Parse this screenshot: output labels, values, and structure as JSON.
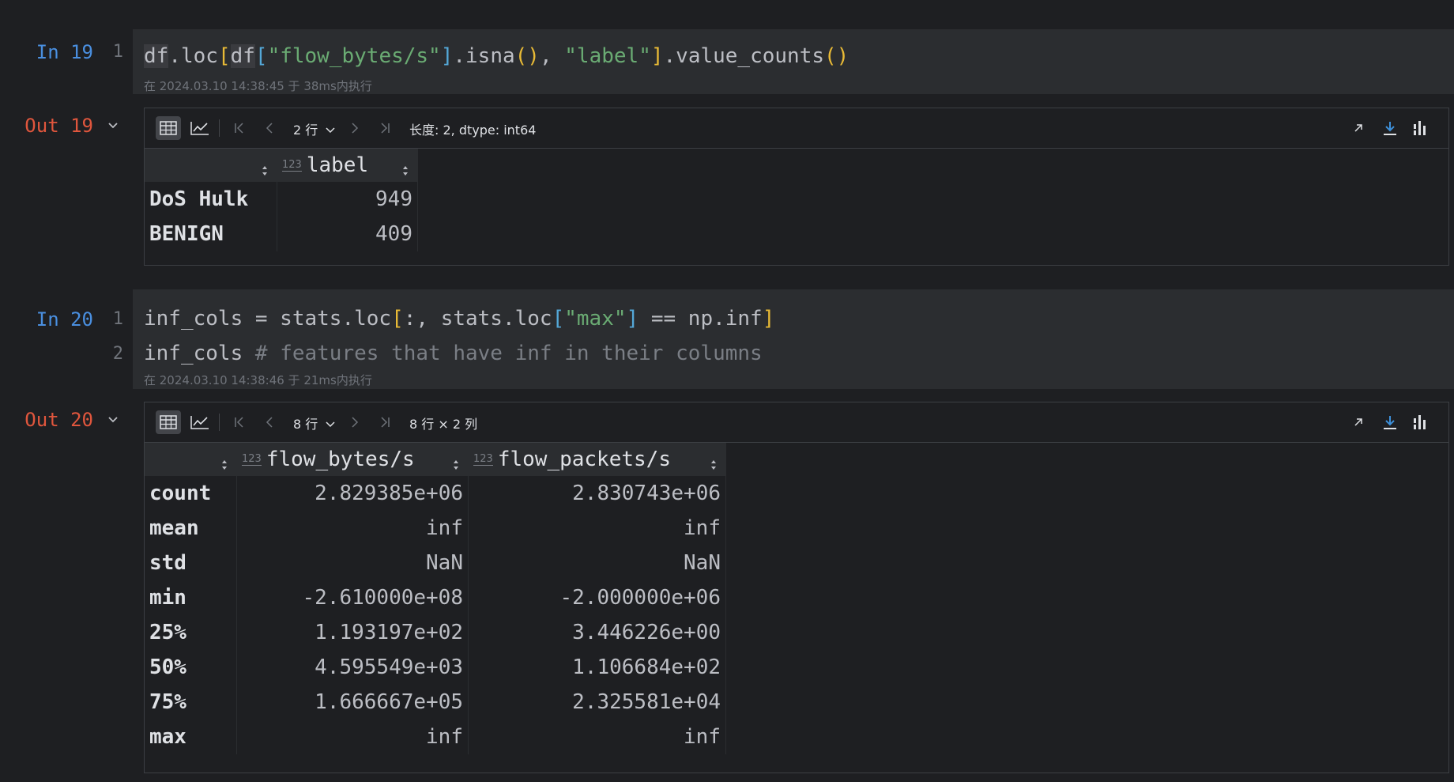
{
  "cells": [
    {
      "in_prompt": "In 19",
      "out_prompt": "Out 19",
      "line_numbers": [
        "1"
      ],
      "code": [
        [
          {
            "t": "df",
            "c": "hl"
          },
          {
            "t": ".loc",
            "c": ""
          },
          {
            "t": "[",
            "c": "br1"
          },
          {
            "t": "df",
            "c": "hl"
          },
          {
            "t": "[",
            "c": "br2"
          },
          {
            "t": "\"flow_bytes/s\"",
            "c": "str"
          },
          {
            "t": "]",
            "c": "br2"
          },
          {
            "t": ".isna",
            "c": ""
          },
          {
            "t": "()",
            "c": "br1"
          },
          {
            "t": ", ",
            "c": ""
          },
          {
            "t": "\"label\"",
            "c": "str"
          },
          {
            "t": "]",
            "c": "br1"
          },
          {
            "t": ".value_counts",
            "c": ""
          },
          {
            "t": "()",
            "c": "br1"
          }
        ]
      ],
      "exec_time": "在 2024.03.10 14:38:45 于 38ms内执行",
      "toolbar": {
        "rows_label": "2 行",
        "info": "长度: 2, dtype: int64"
      },
      "table": {
        "index_header": "",
        "columns": [
          {
            "name": "label",
            "type_badge": "123"
          }
        ],
        "rows": [
          {
            "index": "DoS Hulk",
            "values": [
              "949"
            ]
          },
          {
            "index": "BENIGN",
            "values": [
              "409"
            ]
          }
        ]
      }
    },
    {
      "in_prompt": "In 20",
      "out_prompt": "Out 20",
      "line_numbers": [
        "1",
        "2"
      ],
      "code": [
        [
          {
            "t": "inf_cols = stats.loc",
            "c": ""
          },
          {
            "t": "[",
            "c": "br1"
          },
          {
            "t": ":, stats.loc",
            "c": ""
          },
          {
            "t": "[",
            "c": "br2"
          },
          {
            "t": "\"max\"",
            "c": "str"
          },
          {
            "t": "]",
            "c": "br2"
          },
          {
            "t": " == np.inf",
            "c": ""
          },
          {
            "t": "]",
            "c": "br1"
          }
        ],
        [
          {
            "t": "inf_cols ",
            "c": ""
          },
          {
            "t": "# features that have inf in their columns",
            "c": "com"
          }
        ]
      ],
      "exec_time": "在 2024.03.10 14:38:46 于 21ms内执行",
      "toolbar": {
        "rows_label": "8 行",
        "info": "8 行 × 2 列"
      },
      "table": {
        "index_header": "",
        "columns": [
          {
            "name": "flow_bytes/s",
            "type_badge": "123"
          },
          {
            "name": "flow_packets/s",
            "type_badge": "123"
          }
        ],
        "rows": [
          {
            "index": "count",
            "values": [
              "2.829385e+06",
              "2.830743e+06"
            ]
          },
          {
            "index": "mean",
            "values": [
              "inf",
              "inf"
            ]
          },
          {
            "index": "std",
            "values": [
              "NaN",
              "NaN"
            ]
          },
          {
            "index": "min",
            "values": [
              "-2.610000e+08",
              "-2.000000e+06"
            ]
          },
          {
            "index": "25%",
            "values": [
              "1.193197e+02",
              "3.446226e+00"
            ]
          },
          {
            "index": "50%",
            "values": [
              "4.595549e+03",
              "1.106684e+02"
            ]
          },
          {
            "index": "75%",
            "values": [
              "1.666667e+05",
              "2.325581e+04"
            ]
          },
          {
            "index": "max",
            "values": [
              "inf",
              "inf"
            ]
          }
        ]
      }
    }
  ],
  "icons": {
    "table_view": "table-icon",
    "chart_view": "chart-line-icon",
    "first": "first-page-icon",
    "prev": "prev-page-icon",
    "next": "next-page-icon",
    "last": "last-page-icon",
    "open": "open-external-icon",
    "download": "download-icon",
    "settings": "column-settings-icon"
  },
  "colors": {
    "background": "#1e1f22",
    "cell_background": "#2b2d30",
    "in_prompt": "#4a8fe0",
    "out_prompt": "#e0563d",
    "string": "#6aab73",
    "bracket_outer": "#e8ba36",
    "bracket_inner": "#54a8d8",
    "comment": "#7a7e85",
    "download_accent": "#3d8fd9"
  }
}
